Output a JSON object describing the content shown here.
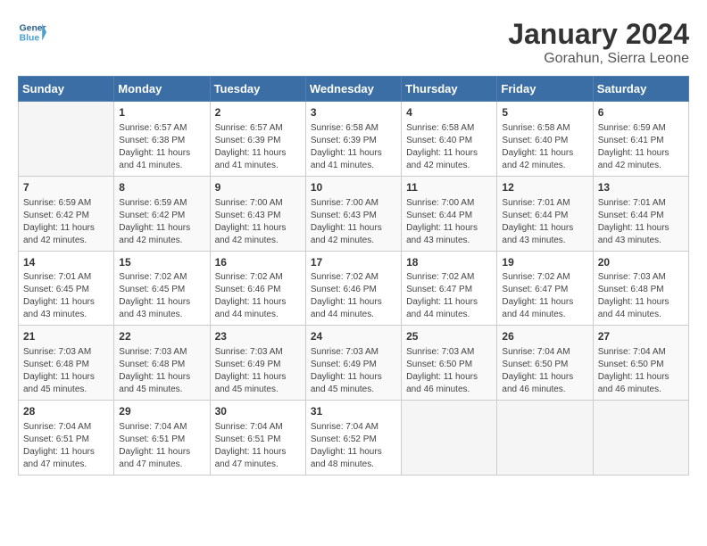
{
  "header": {
    "logo_line1": "General",
    "logo_line2": "Blue",
    "title": "January 2024",
    "subtitle": "Gorahun, Sierra Leone"
  },
  "weekdays": [
    "Sunday",
    "Monday",
    "Tuesday",
    "Wednesday",
    "Thursday",
    "Friday",
    "Saturday"
  ],
  "weeks": [
    [
      {
        "day": "",
        "sunrise": "",
        "sunset": "",
        "daylight": ""
      },
      {
        "day": "1",
        "sunrise": "Sunrise: 6:57 AM",
        "sunset": "Sunset: 6:38 PM",
        "daylight": "Daylight: 11 hours and 41 minutes."
      },
      {
        "day": "2",
        "sunrise": "Sunrise: 6:57 AM",
        "sunset": "Sunset: 6:39 PM",
        "daylight": "Daylight: 11 hours and 41 minutes."
      },
      {
        "day": "3",
        "sunrise": "Sunrise: 6:58 AM",
        "sunset": "Sunset: 6:39 PM",
        "daylight": "Daylight: 11 hours and 41 minutes."
      },
      {
        "day": "4",
        "sunrise": "Sunrise: 6:58 AM",
        "sunset": "Sunset: 6:40 PM",
        "daylight": "Daylight: 11 hours and 42 minutes."
      },
      {
        "day": "5",
        "sunrise": "Sunrise: 6:58 AM",
        "sunset": "Sunset: 6:40 PM",
        "daylight": "Daylight: 11 hours and 42 minutes."
      },
      {
        "day": "6",
        "sunrise": "Sunrise: 6:59 AM",
        "sunset": "Sunset: 6:41 PM",
        "daylight": "Daylight: 11 hours and 42 minutes."
      }
    ],
    [
      {
        "day": "7",
        "sunrise": "Sunrise: 6:59 AM",
        "sunset": "Sunset: 6:42 PM",
        "daylight": "Daylight: 11 hours and 42 minutes."
      },
      {
        "day": "8",
        "sunrise": "Sunrise: 6:59 AM",
        "sunset": "Sunset: 6:42 PM",
        "daylight": "Daylight: 11 hours and 42 minutes."
      },
      {
        "day": "9",
        "sunrise": "Sunrise: 7:00 AM",
        "sunset": "Sunset: 6:43 PM",
        "daylight": "Daylight: 11 hours and 42 minutes."
      },
      {
        "day": "10",
        "sunrise": "Sunrise: 7:00 AM",
        "sunset": "Sunset: 6:43 PM",
        "daylight": "Daylight: 11 hours and 42 minutes."
      },
      {
        "day": "11",
        "sunrise": "Sunrise: 7:00 AM",
        "sunset": "Sunset: 6:44 PM",
        "daylight": "Daylight: 11 hours and 43 minutes."
      },
      {
        "day": "12",
        "sunrise": "Sunrise: 7:01 AM",
        "sunset": "Sunset: 6:44 PM",
        "daylight": "Daylight: 11 hours and 43 minutes."
      },
      {
        "day": "13",
        "sunrise": "Sunrise: 7:01 AM",
        "sunset": "Sunset: 6:44 PM",
        "daylight": "Daylight: 11 hours and 43 minutes."
      }
    ],
    [
      {
        "day": "14",
        "sunrise": "Sunrise: 7:01 AM",
        "sunset": "Sunset: 6:45 PM",
        "daylight": "Daylight: 11 hours and 43 minutes."
      },
      {
        "day": "15",
        "sunrise": "Sunrise: 7:02 AM",
        "sunset": "Sunset: 6:45 PM",
        "daylight": "Daylight: 11 hours and 43 minutes."
      },
      {
        "day": "16",
        "sunrise": "Sunrise: 7:02 AM",
        "sunset": "Sunset: 6:46 PM",
        "daylight": "Daylight: 11 hours and 44 minutes."
      },
      {
        "day": "17",
        "sunrise": "Sunrise: 7:02 AM",
        "sunset": "Sunset: 6:46 PM",
        "daylight": "Daylight: 11 hours and 44 minutes."
      },
      {
        "day": "18",
        "sunrise": "Sunrise: 7:02 AM",
        "sunset": "Sunset: 6:47 PM",
        "daylight": "Daylight: 11 hours and 44 minutes."
      },
      {
        "day": "19",
        "sunrise": "Sunrise: 7:02 AM",
        "sunset": "Sunset: 6:47 PM",
        "daylight": "Daylight: 11 hours and 44 minutes."
      },
      {
        "day": "20",
        "sunrise": "Sunrise: 7:03 AM",
        "sunset": "Sunset: 6:48 PM",
        "daylight": "Daylight: 11 hours and 44 minutes."
      }
    ],
    [
      {
        "day": "21",
        "sunrise": "Sunrise: 7:03 AM",
        "sunset": "Sunset: 6:48 PM",
        "daylight": "Daylight: 11 hours and 45 minutes."
      },
      {
        "day": "22",
        "sunrise": "Sunrise: 7:03 AM",
        "sunset": "Sunset: 6:48 PM",
        "daylight": "Daylight: 11 hours and 45 minutes."
      },
      {
        "day": "23",
        "sunrise": "Sunrise: 7:03 AM",
        "sunset": "Sunset: 6:49 PM",
        "daylight": "Daylight: 11 hours and 45 minutes."
      },
      {
        "day": "24",
        "sunrise": "Sunrise: 7:03 AM",
        "sunset": "Sunset: 6:49 PM",
        "daylight": "Daylight: 11 hours and 45 minutes."
      },
      {
        "day": "25",
        "sunrise": "Sunrise: 7:03 AM",
        "sunset": "Sunset: 6:50 PM",
        "daylight": "Daylight: 11 hours and 46 minutes."
      },
      {
        "day": "26",
        "sunrise": "Sunrise: 7:04 AM",
        "sunset": "Sunset: 6:50 PM",
        "daylight": "Daylight: 11 hours and 46 minutes."
      },
      {
        "day": "27",
        "sunrise": "Sunrise: 7:04 AM",
        "sunset": "Sunset: 6:50 PM",
        "daylight": "Daylight: 11 hours and 46 minutes."
      }
    ],
    [
      {
        "day": "28",
        "sunrise": "Sunrise: 7:04 AM",
        "sunset": "Sunset: 6:51 PM",
        "daylight": "Daylight: 11 hours and 47 minutes."
      },
      {
        "day": "29",
        "sunrise": "Sunrise: 7:04 AM",
        "sunset": "Sunset: 6:51 PM",
        "daylight": "Daylight: 11 hours and 47 minutes."
      },
      {
        "day": "30",
        "sunrise": "Sunrise: 7:04 AM",
        "sunset": "Sunset: 6:51 PM",
        "daylight": "Daylight: 11 hours and 47 minutes."
      },
      {
        "day": "31",
        "sunrise": "Sunrise: 7:04 AM",
        "sunset": "Sunset: 6:52 PM",
        "daylight": "Daylight: 11 hours and 48 minutes."
      },
      {
        "day": "",
        "sunrise": "",
        "sunset": "",
        "daylight": ""
      },
      {
        "day": "",
        "sunrise": "",
        "sunset": "",
        "daylight": ""
      },
      {
        "day": "",
        "sunrise": "",
        "sunset": "",
        "daylight": ""
      }
    ]
  ]
}
